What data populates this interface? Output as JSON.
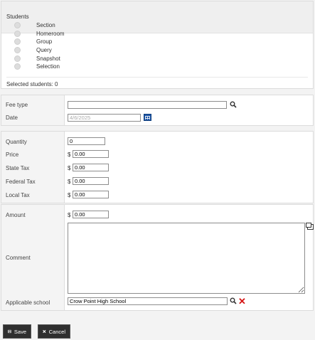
{
  "students": {
    "title": "Students",
    "options": [
      "Section",
      "Homeroom",
      "Group",
      "Query",
      "Snapshot",
      "Selection"
    ],
    "selected_text": "Selected students:  0"
  },
  "fee": {
    "fee_type_label": "Fee type",
    "fee_type_value": "",
    "date_label": "Date",
    "date_value": "4/6/2025"
  },
  "taxes": {
    "quantity_label": "Quantity",
    "quantity_value": "0",
    "price_label": "Price",
    "price_value": "0.00",
    "state_tax_label": "State Tax",
    "state_tax_value": "0.00",
    "federal_tax_label": "Federal Tax",
    "federal_tax_value": "0.00",
    "local_tax_label": "Local Tax",
    "local_tax_value": "0.00",
    "currency_symbol": "$"
  },
  "amount": {
    "amount_label": "Amount",
    "amount_value": "0.00",
    "comment_label": "Comment",
    "comment_value": "",
    "school_label": "Applicable school",
    "school_value": "Crow Point High School"
  },
  "buttons": {
    "save": "Save",
    "cancel": "Cancel"
  },
  "icons": {
    "search": "search-icon",
    "calendar": "calendar-icon",
    "clear": "clear-icon",
    "expand": "expand-icon",
    "save": "save-icon",
    "cancel": "cancel-icon"
  }
}
